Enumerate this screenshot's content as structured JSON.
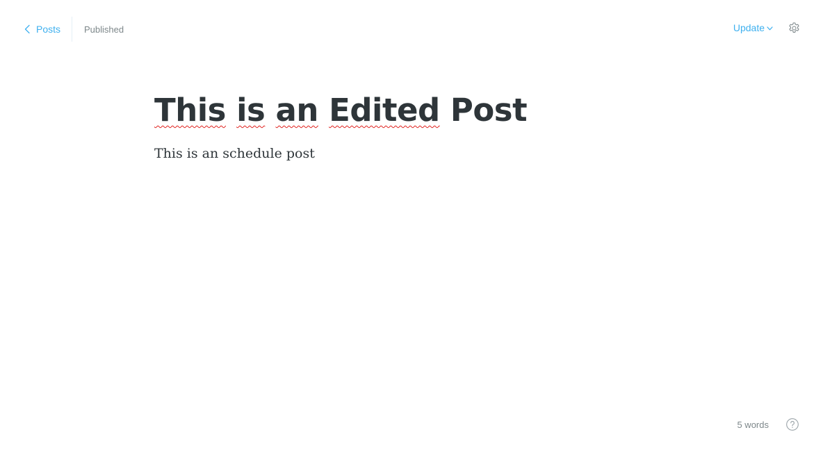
{
  "header": {
    "back_label": "Posts",
    "status": "Published",
    "update_label": "Update"
  },
  "post": {
    "title_words": [
      "This",
      "is",
      "an",
      "Edited",
      "Post"
    ],
    "body": "This is an schedule post"
  },
  "footer": {
    "word_count": "5 words"
  },
  "icons": {
    "back": "chevron-left-icon",
    "update_caret": "chevron-down-icon",
    "settings": "gear-icon",
    "help": "question-circle-icon"
  },
  "colors": {
    "accent": "#3eb0ef",
    "text": "#2e3539",
    "muted": "#7d878a",
    "spellcheck": "#e0201c"
  }
}
